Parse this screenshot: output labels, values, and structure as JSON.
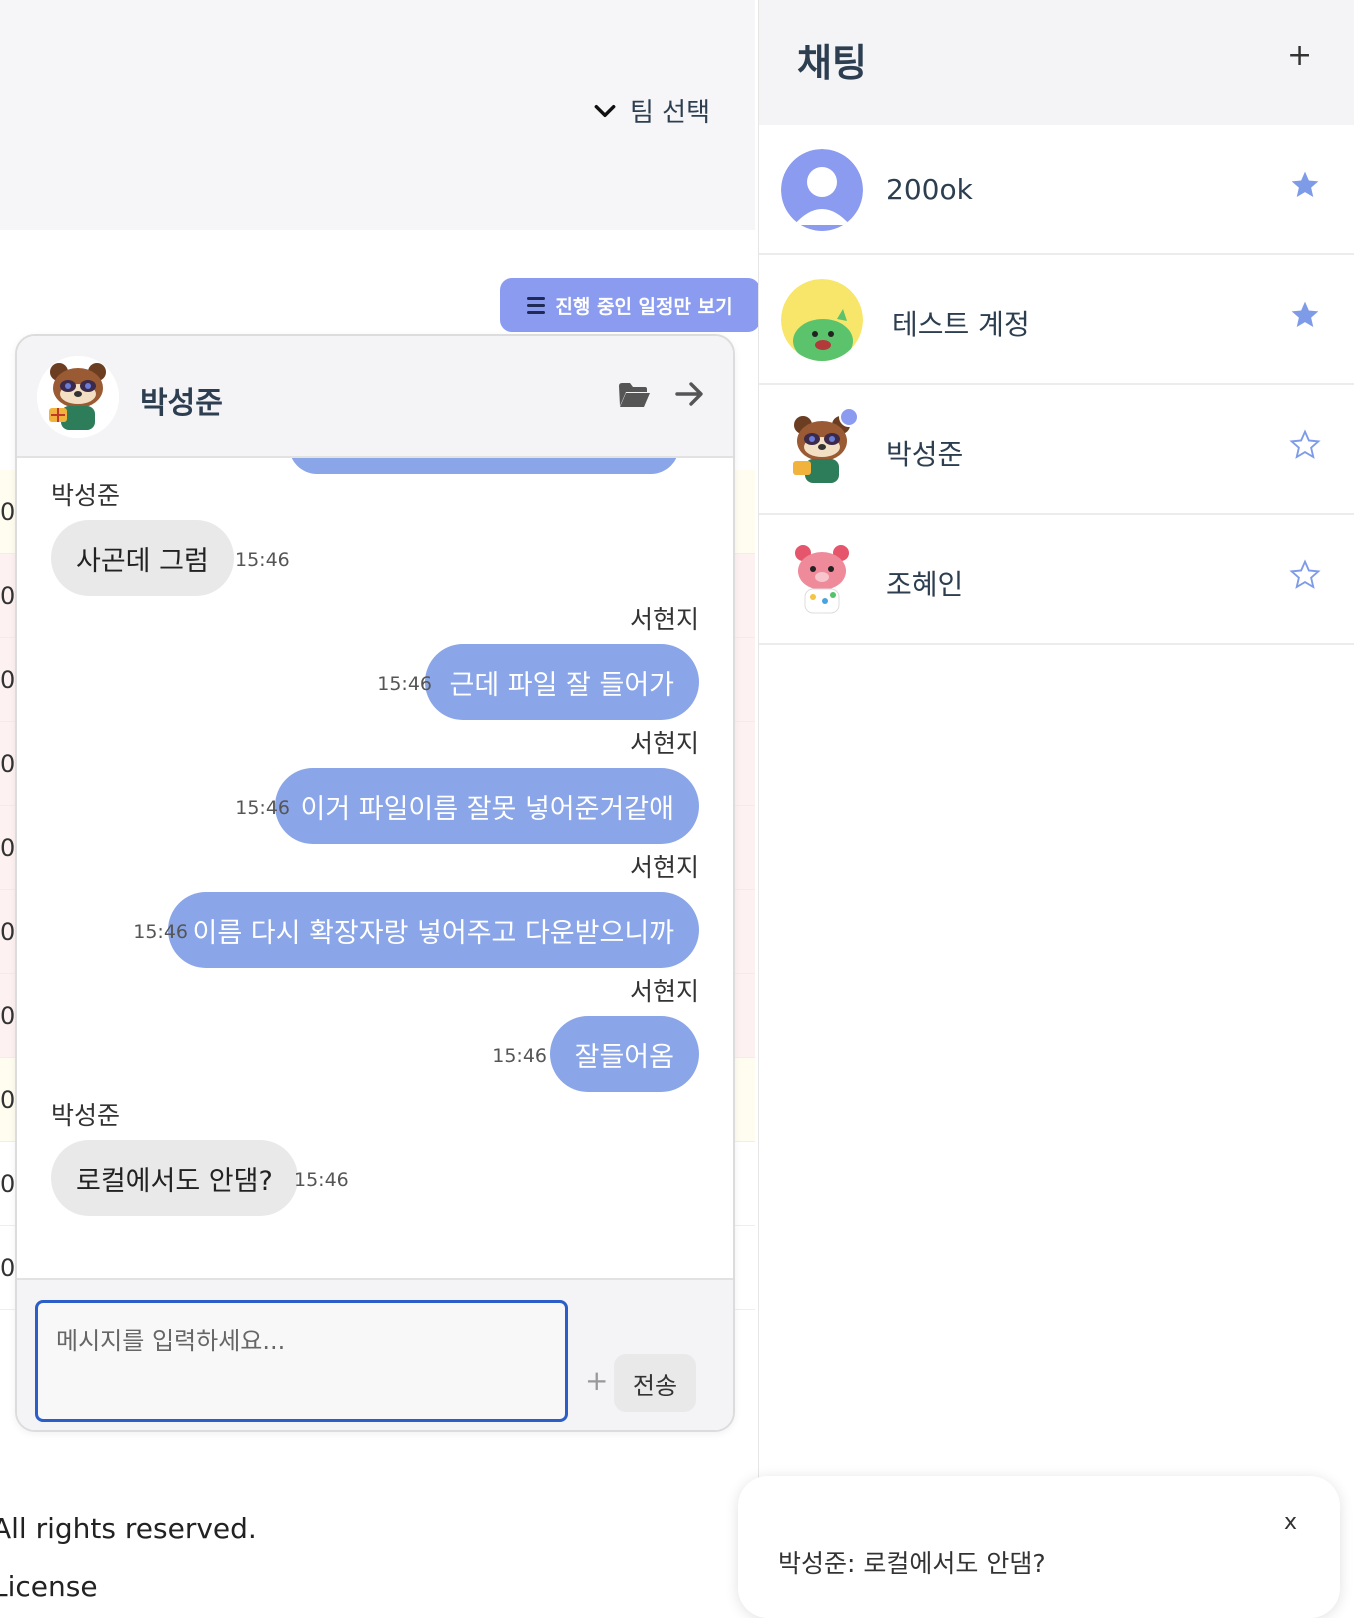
{
  "page": {
    "team_select_label": "팀 선택",
    "progress_filter_label": "진행 중인 일정만 보기",
    "row_markers": [
      "0",
      "0",
      "0",
      "0",
      "0",
      "0",
      "0",
      "0",
      "0",
      "0"
    ],
    "footer_rights": "All rights reserved.",
    "footer_license": "License"
  },
  "chat": {
    "partner_name": "박성준",
    "messages": [
      {
        "sender": "박성준",
        "text": "사곤데 그럼",
        "time": "15:46",
        "direction": "in"
      },
      {
        "sender": "서현지",
        "text": "근데 파일 잘 들어가",
        "time": "15:46",
        "direction": "out"
      },
      {
        "sender": "서현지",
        "text": "이거 파일이름 잘못 넣어준거같애",
        "time": "15:46",
        "direction": "out"
      },
      {
        "sender": "서현지",
        "text": "이름 다시 확장자랑 넣어주고 다운받으니까",
        "time": "15:46",
        "direction": "out"
      },
      {
        "sender": "서현지",
        "text": "잘들어옴",
        "time": "15:46",
        "direction": "out"
      },
      {
        "sender": "박성준",
        "text": "로컬에서도 안댐?",
        "time": "15:46",
        "direction": "in"
      }
    ],
    "input_placeholder": "메시지를 입력하세요...",
    "attach_label": "+",
    "send_label": "전송"
  },
  "panel": {
    "title": "채팅",
    "add_label": "+",
    "rooms": [
      {
        "name": "200ok",
        "favorite": true,
        "avatar": "default-user-icon"
      },
      {
        "name": "테스트 계정",
        "favorite": true,
        "avatar": "green-dino-avatar"
      },
      {
        "name": "박성준",
        "favorite": false,
        "avatar": "raccoon-avatar",
        "unread": true
      },
      {
        "name": "조혜인",
        "favorite": false,
        "avatar": "pink-bear-avatar"
      }
    ]
  },
  "toast": {
    "close_label": "x",
    "message": "박성준: 로컬에서도 안댐?"
  },
  "colors": {
    "accent": "#8b9cf0",
    "bubble_out": "#8aa6e8",
    "bubble_in": "#e9e9e9",
    "title_text": "#2c3e50",
    "input_border": "#2b5fc7"
  }
}
